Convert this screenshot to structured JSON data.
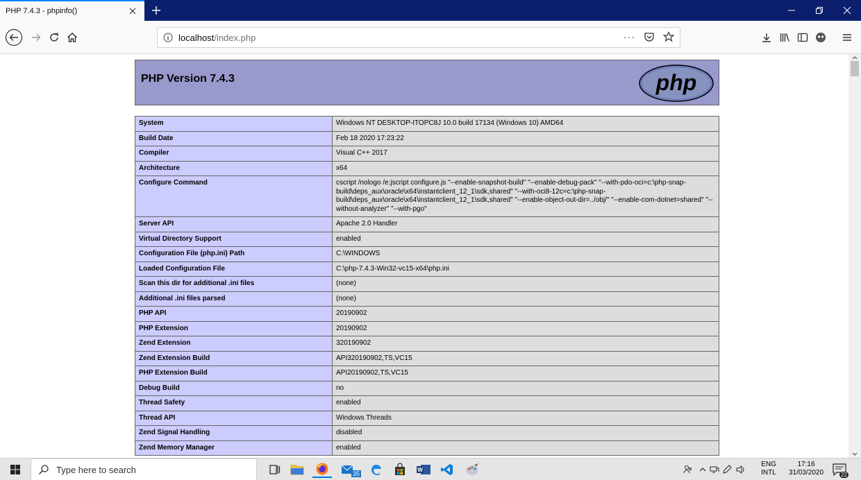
{
  "browser": {
    "tab_title": "PHP 7.4.3 - phpinfo()",
    "url_host": "localhost",
    "url_path": "/index.php",
    "page_actions_dots": "···"
  },
  "page": {
    "php_version": "PHP Version 7.4.3",
    "logo_text": "php",
    "rows": [
      {
        "key": "System",
        "value": "Windows NT DESKTOP-ITOPC8J 10.0 build 17134 (Windows 10) AMD64"
      },
      {
        "key": "Build Date",
        "value": "Feb 18 2020 17:23:22"
      },
      {
        "key": "Compiler",
        "value": "Visual C++ 2017"
      },
      {
        "key": "Architecture",
        "value": "x64"
      },
      {
        "key": "Configure Command",
        "value": "cscript /nologo /e:jscript configure.js \"--enable-snapshot-build\" \"--enable-debug-pack\" \"--with-pdo-oci=c:\\php-snap-build\\deps_aux\\oracle\\x64\\instantclient_12_1\\sdk,shared\" \"--with-oci8-12c=c:\\php-snap-build\\deps_aux\\oracle\\x64\\instantclient_12_1\\sdk,shared\" \"--enable-object-out-dir=../obj/\" \"--enable-com-dotnet=shared\" \"--without-analyzer\" \"--with-pgo\""
      },
      {
        "key": "Server API",
        "value": "Apache 2.0 Handler"
      },
      {
        "key": "Virtual Directory Support",
        "value": "enabled"
      },
      {
        "key": "Configuration File (php.ini) Path",
        "value": "C:\\WINDOWS"
      },
      {
        "key": "Loaded Configuration File",
        "value": "C:\\php-7.4.3-Win32-vc15-x64\\php.ini"
      },
      {
        "key": "Scan this dir for additional .ini files",
        "value": "(none)"
      },
      {
        "key": "Additional .ini files parsed",
        "value": "(none)"
      },
      {
        "key": "PHP API",
        "value": "20190902"
      },
      {
        "key": "PHP Extension",
        "value": "20190902"
      },
      {
        "key": "Zend Extension",
        "value": "320190902"
      },
      {
        "key": "Zend Extension Build",
        "value": "API320190902,TS,VC15"
      },
      {
        "key": "PHP Extension Build",
        "value": "API20190902,TS,VC15"
      },
      {
        "key": "Debug Build",
        "value": "no"
      },
      {
        "key": "Thread Safety",
        "value": "enabled"
      },
      {
        "key": "Thread API",
        "value": "Windows Threads"
      },
      {
        "key": "Zend Signal Handling",
        "value": "disabled"
      },
      {
        "key": "Zend Memory Manager",
        "value": "enabled"
      }
    ]
  },
  "taskbar": {
    "search_placeholder": "Type here to search",
    "mail_badge": "35",
    "lang_line1": "ENG",
    "lang_line2": "INTL",
    "time": "17:16",
    "date": "31/03/2020",
    "notification_count": "22"
  },
  "colors": {
    "header_bg": "#9999cc",
    "key_bg": "#ccccff",
    "value_bg": "#dddddd",
    "tabstrip_bg": "#0c1f6e"
  }
}
